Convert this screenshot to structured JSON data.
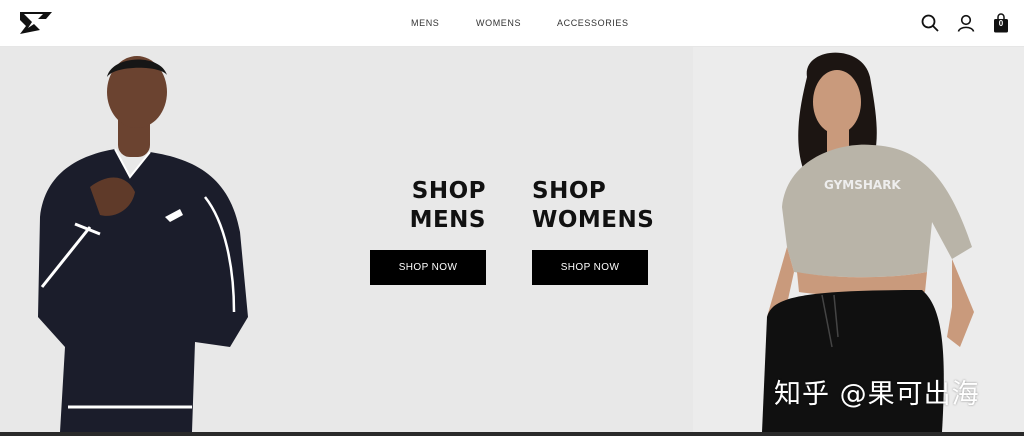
{
  "header": {
    "logo_icon": "gymshark-logo-icon",
    "nav": [
      {
        "label": "MENS"
      },
      {
        "label": "WOMENS"
      },
      {
        "label": "ACCESSORIES"
      }
    ],
    "icons": {
      "search": "search-icon",
      "account": "user-icon",
      "bag": "bag-icon"
    },
    "bag_count": "0"
  },
  "hero": {
    "mens": {
      "title_line1": "SHOP",
      "title_line2": "MENS",
      "button": "SHOP NOW"
    },
    "womens": {
      "title_line1": "SHOP",
      "title_line2": "WOMENS",
      "button": "SHOP NOW"
    },
    "shirt_print": "GYMSHARK"
  },
  "watermark": "知乎 @果可出海",
  "colors": {
    "hero_bg": "#e8e8e8",
    "button_bg": "#000000",
    "button_text": "#ffffff"
  }
}
